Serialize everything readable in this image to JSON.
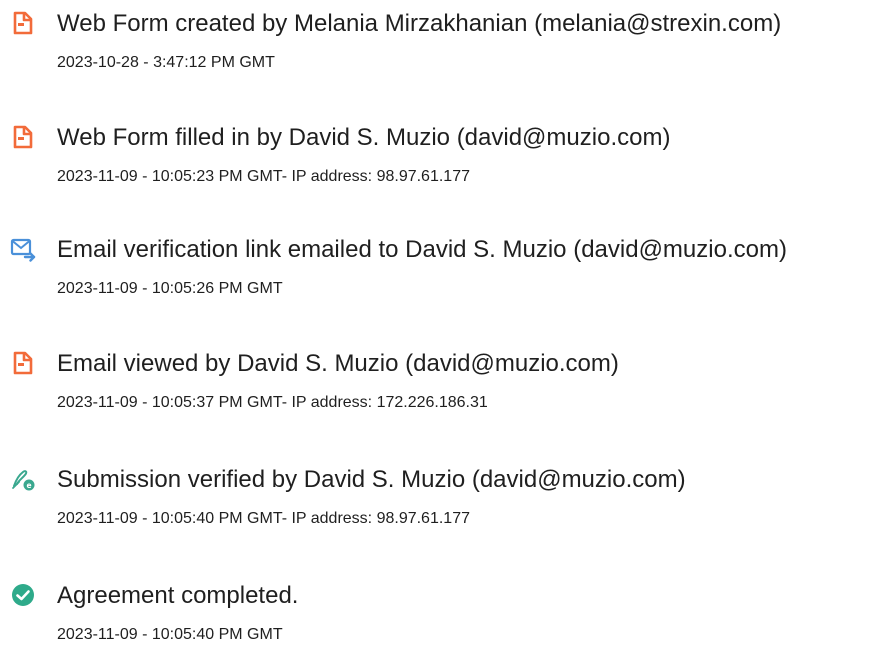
{
  "events": [
    {
      "icon": "document-form-icon",
      "title": "Web Form created by Melania Mirzakhanian (melania@strexin.com)",
      "timestamp": "2023-10-28 - 3:47:12 PM GMT"
    },
    {
      "icon": "document-form-icon",
      "title": "Web Form filled in by David S. Muzio (david@muzio.com)",
      "timestamp": "2023-11-09 - 10:05:23 PM GMT- IP address: 98.97.61.177"
    },
    {
      "icon": "email-send-icon",
      "title": "Email verification link emailed to David S. Muzio (david@muzio.com)",
      "timestamp": "2023-11-09 - 10:05:26 PM GMT"
    },
    {
      "icon": "document-form-icon",
      "title": "Email viewed by David S. Muzio (david@muzio.com)",
      "timestamp": "2023-11-09 - 10:05:37 PM GMT- IP address: 172.226.186.31"
    },
    {
      "icon": "signature-verified-icon",
      "title": "Submission verified by David S. Muzio (david@muzio.com)",
      "timestamp": "2023-11-09 - 10:05:40 PM GMT- IP address: 98.97.61.177"
    },
    {
      "icon": "check-circle-icon",
      "title": "Agreement completed.",
      "timestamp": "2023-11-09 - 10:05:40 PM GMT"
    }
  ],
  "colors": {
    "document_icon": "#f26b3a",
    "email_icon": "#4a90d9",
    "signature_icon": "#3aa88f",
    "check_icon": "#2eaa8a",
    "text": "#1f1f1f"
  }
}
